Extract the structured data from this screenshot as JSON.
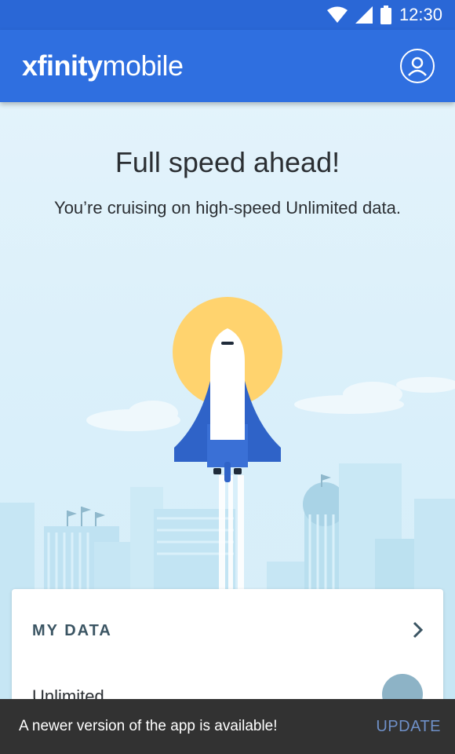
{
  "status_bar": {
    "time": "12:30",
    "icons": [
      "wifi-icon",
      "signal-icon",
      "battery-icon"
    ]
  },
  "app_bar": {
    "logo_bold": "xfinity",
    "logo_light": "mobile",
    "profile_icon": "profile-icon"
  },
  "hero": {
    "title": "Full speed ahead!",
    "subtitle": "You’re cruising on high-speed Unlimited data."
  },
  "card": {
    "title": "MY DATA",
    "plan": "Unlimited",
    "chevron_icon": "chevron-right-icon"
  },
  "snackbar": {
    "message": "A newer version of the app is available!",
    "action": "UPDATE"
  },
  "colors": {
    "brand_blue": "#2f6fe0",
    "rocket_blue": "#2f63c8",
    "sun": "#ffd36e",
    "snackbar": "#323232"
  }
}
